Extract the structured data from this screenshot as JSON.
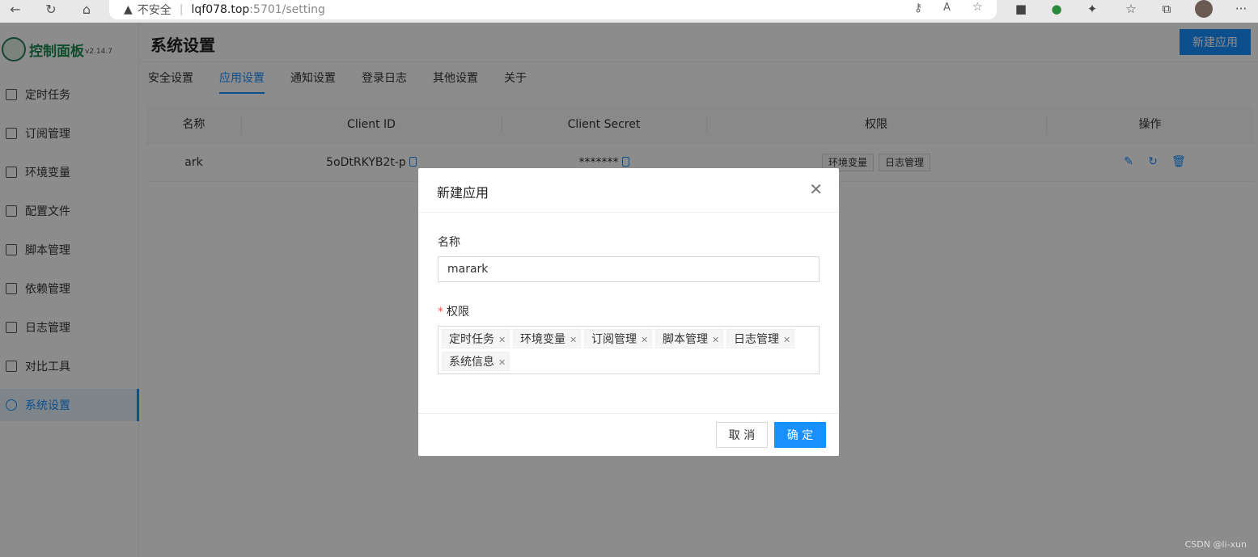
{
  "browser": {
    "security_label": "不安全",
    "url_host": "lqf078.top",
    "url_port_path": ":5701/setting"
  },
  "sidebar": {
    "logo_text": "控制面板",
    "version": "v2.14.7",
    "items": [
      {
        "label": "定时任务",
        "icon": "calendar-icon"
      },
      {
        "label": "订阅管理",
        "icon": "subscription-icon"
      },
      {
        "label": "环境变量",
        "icon": "desktop-icon"
      },
      {
        "label": "配置文件",
        "icon": "sliders-icon"
      },
      {
        "label": "脚本管理",
        "icon": "code-icon"
      },
      {
        "label": "依赖管理",
        "icon": "database-icon"
      },
      {
        "label": "日志管理",
        "icon": "file-search-icon"
      },
      {
        "label": "对比工具",
        "icon": "diff-icon"
      },
      {
        "label": "系统设置",
        "icon": "setting-icon",
        "active": true
      }
    ]
  },
  "header": {
    "title": "系统设置",
    "new_app_button": "新建应用"
  },
  "tabs": [
    {
      "label": "安全设置"
    },
    {
      "label": "应用设置",
      "active": true
    },
    {
      "label": "通知设置"
    },
    {
      "label": "登录日志"
    },
    {
      "label": "其他设置"
    },
    {
      "label": "关于"
    }
  ],
  "table": {
    "columns": [
      "名称",
      "Client ID",
      "Client Secret",
      "权限",
      "操作"
    ],
    "rows": [
      {
        "name": "ark",
        "client_id": "5oDtRKYB2t-p",
        "client_secret": "*******",
        "permissions": [
          "环境变量",
          "日志管理"
        ]
      }
    ]
  },
  "modal": {
    "title": "新建应用",
    "name_label": "名称",
    "name_value": "marark",
    "perm_label": "权限",
    "required_mark": "*",
    "selected_permissions": [
      "定时任务",
      "环境变量",
      "订阅管理",
      "脚本管理",
      "日志管理",
      "系统信息"
    ],
    "cancel_label": "取 消",
    "ok_label": "确 定"
  },
  "watermark": "CSDN @li-xun",
  "colors": {
    "primary": "#1890ff",
    "brand_green": "#1c8a4f"
  }
}
